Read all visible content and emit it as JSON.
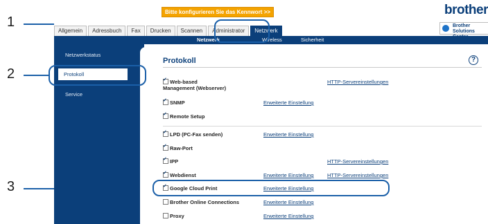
{
  "callouts": [
    "1",
    "2",
    "3"
  ],
  "warning": "Bitte konfigurieren Sie das Kennwort >>",
  "brand": "brother",
  "solutions_center": "Brother Solutions Center",
  "tabs": [
    "Allgemein",
    "Adressbuch",
    "Fax",
    "Drucken",
    "Scannen",
    "Administrator",
    "Netzwerk"
  ],
  "subnav": [
    "Netzwerk",
    "Wireless",
    "Sicherheit"
  ],
  "sidebar": [
    "Netzwerkstatus",
    "Protokoll",
    "Service"
  ],
  "content": {
    "title": "Protokoll",
    "help": "?",
    "rows": [
      {
        "label": "Web-based",
        "label2": "Management (Webserver)",
        "checked": true,
        "link_mid": "",
        "link_right": "HTTP-Servereinstellungen"
      },
      {
        "label": "SNMP",
        "checked": true,
        "link_mid": "Erweiterte Einstellung",
        "link_right": ""
      },
      {
        "label": "Remote Setup",
        "checked": true,
        "link_mid": "",
        "link_right": ""
      },
      {
        "label": "LPD (PC-Fax senden)",
        "checked": true,
        "link_mid": "Erweiterte Einstellung",
        "link_right": ""
      },
      {
        "label": "Raw-Port",
        "checked": true,
        "link_mid": "",
        "link_right": ""
      },
      {
        "label": "IPP",
        "checked": true,
        "link_mid": "",
        "link_right": "HTTP-Servereinstellungen"
      },
      {
        "label": "Webdienst",
        "checked": true,
        "link_mid": "Erweiterte Einstellung",
        "link_right": "HTTP-Servereinstellungen"
      },
      {
        "label": "Google Cloud Print",
        "checked": true,
        "link_mid": "Erweiterte Einstellung",
        "link_right": ""
      },
      {
        "label": "Brother Online Connections",
        "checked": false,
        "link_mid": "Erweiterte Einstellung",
        "link_right": ""
      },
      {
        "label": "Proxy",
        "checked": false,
        "link_mid": "Erweiterte Einstellung",
        "link_right": ""
      }
    ]
  },
  "colors": {
    "brand_blue": "#0b3f7a",
    "callout_blue": "#1a5fa8",
    "warning_orange": "#f4a300"
  }
}
